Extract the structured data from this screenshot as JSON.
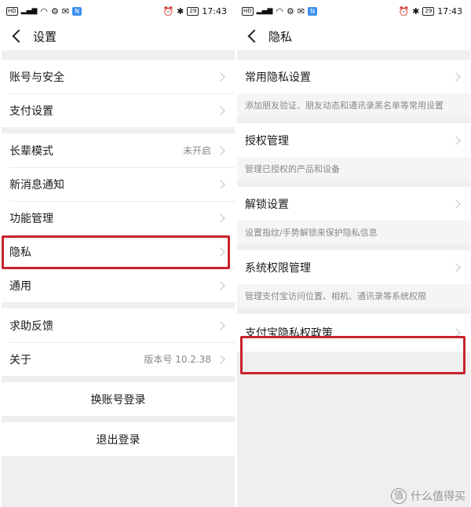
{
  "status": {
    "time": "17:43",
    "battery": "29",
    "left_label": "HD",
    "badge_text": "N"
  },
  "left": {
    "title": "设置",
    "group1": [
      {
        "label": "账号与安全",
        "value": ""
      },
      {
        "label": "支付设置",
        "value": ""
      }
    ],
    "group2": [
      {
        "label": "长辈模式",
        "value": "未开启"
      },
      {
        "label": "新消息通知",
        "value": ""
      },
      {
        "label": "功能管理",
        "value": ""
      },
      {
        "label": "隐私",
        "value": ""
      },
      {
        "label": "通用",
        "value": ""
      }
    ],
    "group3": [
      {
        "label": "求助反馈",
        "value": ""
      },
      {
        "label": "关于",
        "value": "版本号 10.2.38"
      }
    ],
    "switch_account": "换账号登录",
    "logout": "退出登录"
  },
  "right": {
    "title": "隐私",
    "items": [
      {
        "label": "常用隐私设置",
        "desc": "添加朋友验证、朋友动态和通讯录黑名单等常用设置"
      },
      {
        "label": "授权管理",
        "desc": "管理已授权的产品和设备"
      },
      {
        "label": "解锁设置",
        "desc": "设置指纹/手势解锁来保护隐私信息"
      },
      {
        "label": "系统权限管理",
        "desc": "管理支付宝访问位置、相机、通讯录等系统权限"
      },
      {
        "label": "支付宝隐私权政策",
        "desc": ""
      }
    ]
  },
  "watermark": {
    "icon_text": "值",
    "text": "什么值得买"
  },
  "colors": {
    "highlight": "#c8232c",
    "background": "#efefef"
  }
}
